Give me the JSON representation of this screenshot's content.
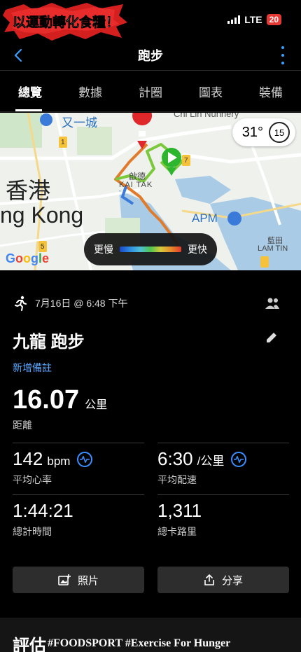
{
  "status": {
    "logo_text": "以運動轉化食糧！",
    "network": "LTE",
    "battery": "20"
  },
  "nav": {
    "title": "跑步"
  },
  "tabs": [
    {
      "label": "總覽",
      "active": true
    },
    {
      "label": "數據",
      "active": false
    },
    {
      "label": "計圈",
      "active": false
    },
    {
      "label": "圖表",
      "active": false
    },
    {
      "label": "裝備",
      "active": false
    }
  ],
  "map": {
    "temperature": "31°",
    "wind": "15",
    "pace_slow": "更慢",
    "pace_fast": "更快",
    "labels": {
      "city": "又一城",
      "hk_chinese": "香港",
      "hk_english": "ng Kong",
      "kaitak_cn": "啟德",
      "kaitak_en": "KAI TAK",
      "apm": "APM",
      "lamtin_cn": "藍田",
      "lamtin_en": "LAM TIN",
      "chilin": "Chi Lin Nunnery",
      "route_1": "1",
      "route_5": "5",
      "route_7": "7"
    },
    "attribution": "Google"
  },
  "activity": {
    "date": "7月16日 @ 6:48 下午",
    "name": "九龍 跑步",
    "add_note": "新增備註",
    "distance": {
      "value": "16.07",
      "unit": "公里",
      "label": "距離"
    },
    "avg_hr": {
      "value": "142",
      "unit": "bpm",
      "label": "平均心率"
    },
    "avg_pace": {
      "value": "6:30",
      "unit": "/公里",
      "label": "平均配速"
    },
    "total_time": {
      "value": "1:44:21",
      "label": "總計時間"
    },
    "calories": {
      "value": "1,311",
      "label": "總卡路里"
    }
  },
  "actions": {
    "photos": "照片",
    "share": "分享"
  },
  "evaluation": {
    "title": "評估",
    "hashtag": "#FOODSPORT #Exercise For Hunger"
  },
  "colors": {
    "accent_blue": "#3aa0ff",
    "link_blue": "#5aa8ff",
    "route_green": "#7cc83c",
    "start_green": "#2db52d",
    "end_red": "#e0282b"
  }
}
